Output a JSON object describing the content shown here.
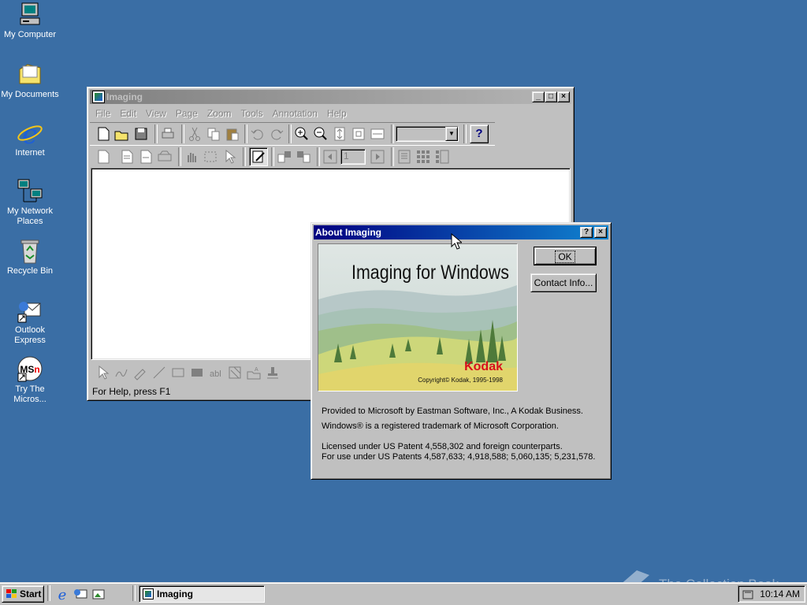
{
  "desktop": {
    "icons": [
      {
        "label": "My Computer"
      },
      {
        "label": "My Documents"
      },
      {
        "label": "Internet"
      },
      {
        "label": "My Network Places"
      },
      {
        "label": "Recycle Bin"
      },
      {
        "label": "Outlook Express"
      },
      {
        "label": "Try The Micros..."
      }
    ]
  },
  "imaging_window": {
    "title": "Imaging",
    "menu": [
      "File",
      "Edit",
      "View",
      "Page",
      "Zoom",
      "Tools",
      "Annotation",
      "Help"
    ],
    "page_number": "1",
    "status": "For Help, press F1"
  },
  "about_dialog": {
    "title": "About Imaging",
    "help_btn": "?",
    "close_btn": "×",
    "ok_label": "OK",
    "contact_label": "Contact Info...",
    "banner_title": "Imaging for Windows",
    "banner_brand": "Kodak",
    "banner_copyright": "Copyright© Kodak, 1995-1998",
    "line1": "Provided to Microsoft by Eastman Software, Inc., A Kodak Business.",
    "line2": "Windows® is a registered trademark of Microsoft Corporation.",
    "line3": "Licensed under US Patent 4,558,302 and foreign counterparts.",
    "line4": "For use under US Patents 4,587,633; 4,918,588; 5,060,135; 5,231,578."
  },
  "taskbar": {
    "start_label": "Start",
    "task_label": "Imaging",
    "clock": "10:14 AM"
  },
  "watermark": "The Collection Book"
}
